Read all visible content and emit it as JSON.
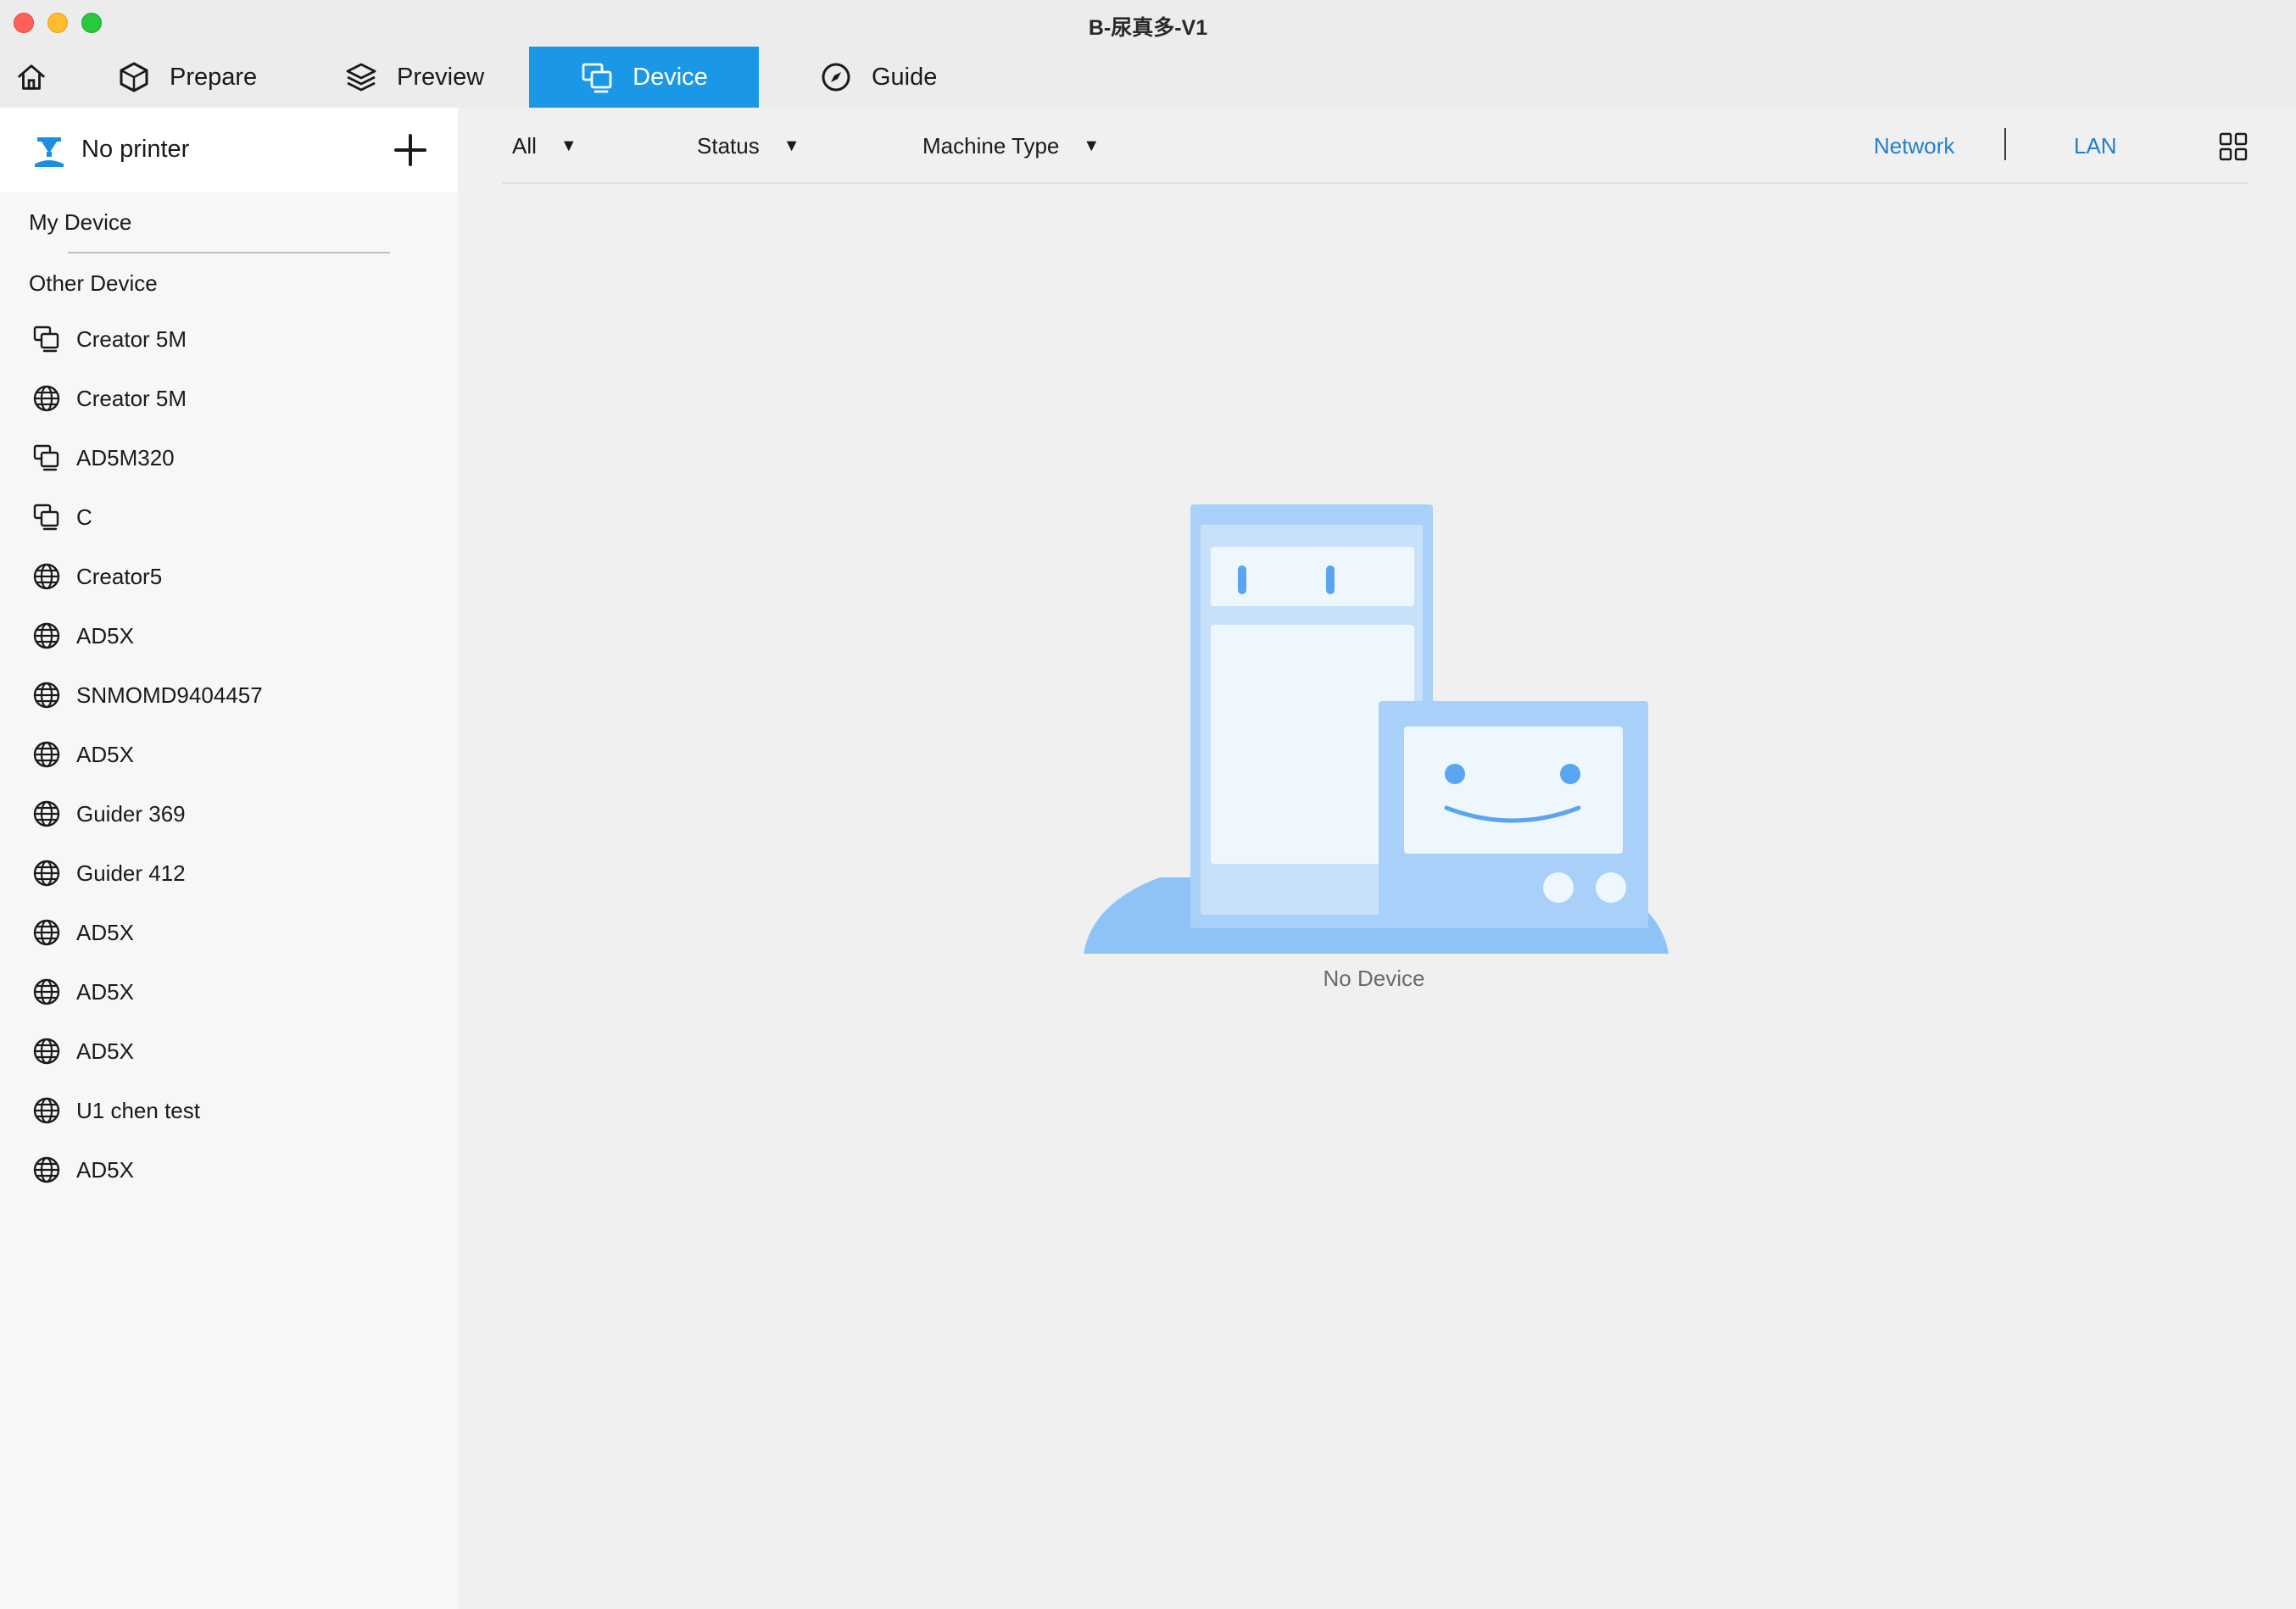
{
  "window": {
    "title": "B-尿真多-V1"
  },
  "tabs": [
    {
      "label": "Prepare"
    },
    {
      "label": "Preview"
    },
    {
      "label": "Device"
    },
    {
      "label": "Guide"
    }
  ],
  "sidebar": {
    "printer_label": "No printer",
    "my_device_label": "My Device",
    "other_device_label": "Other Device",
    "devices": [
      {
        "name": "Creator 5M",
        "icon": "lan-printer-icon"
      },
      {
        "name": "Creator 5M",
        "icon": "globe-icon"
      },
      {
        "name": "AD5M320",
        "icon": "lan-printer-icon"
      },
      {
        "name": "C",
        "icon": "lan-printer-icon"
      },
      {
        "name": "Creator5",
        "icon": "globe-icon"
      },
      {
        "name": "AD5X",
        "icon": "globe-icon"
      },
      {
        "name": "SNMOMD9404457",
        "icon": "globe-icon"
      },
      {
        "name": "AD5X",
        "icon": "globe-icon"
      },
      {
        "name": "Guider 369",
        "icon": "globe-icon"
      },
      {
        "name": "Guider 412",
        "icon": "globe-icon"
      },
      {
        "name": "AD5X",
        "icon": "globe-icon"
      },
      {
        "name": "AD5X",
        "icon": "globe-icon"
      },
      {
        "name": "AD5X",
        "icon": "globe-icon"
      },
      {
        "name": "U1 chen test",
        "icon": "globe-icon"
      },
      {
        "name": "AD5X",
        "icon": "globe-icon"
      }
    ]
  },
  "filters": {
    "all_label": "All",
    "status_label": "Status",
    "machine_type_label": "Machine Type",
    "network_label": "Network",
    "lan_label": "LAN"
  },
  "main": {
    "empty_text": "No Device"
  },
  "colors": {
    "accent": "#1a98e6",
    "link": "#1f7fd1",
    "illustration": "#8fc3f7"
  }
}
